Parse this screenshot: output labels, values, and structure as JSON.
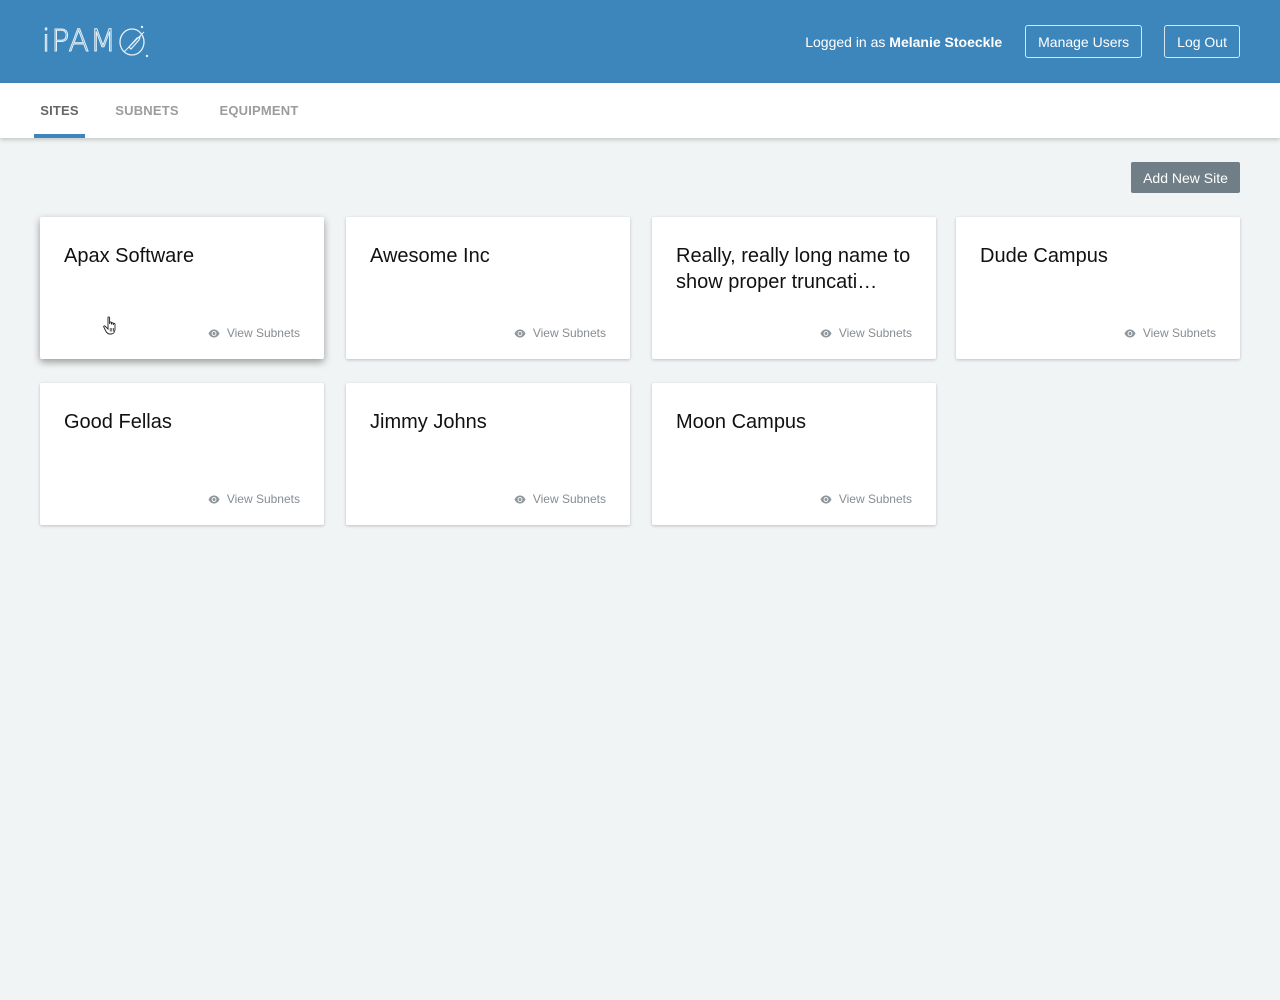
{
  "header": {
    "logo_text": "iPAM",
    "logged_in_prefix": "Logged in as ",
    "user_name": "Melanie Stoeckle",
    "buttons": [
      {
        "label": "Manage Users"
      },
      {
        "label": "Log Out"
      }
    ],
    "colors": {
      "brand": "#3d86bc"
    }
  },
  "tabs": [
    {
      "label": "SITES",
      "active": true
    },
    {
      "label": "SUBNETS",
      "active": false
    },
    {
      "label": "EQUIPMENT",
      "active": false
    }
  ],
  "toolbar": {
    "add_site_label": "Add New Site"
  },
  "sites": [
    {
      "name": "Apax Software",
      "link": "View Subnets",
      "link_icon": "eye-icon"
    },
    {
      "name": "Awesome Inc",
      "link": "View Subnets",
      "link_icon": "eye-icon"
    },
    {
      "name": "Really, really long name to show proper truncati…",
      "link": "View Subnets",
      "link_icon": "eye-icon"
    },
    {
      "name": "Dude Campus",
      "link": "View Subnets",
      "link_icon": "eye-icon"
    },
    {
      "name": "Good Fellas",
      "link": "View Subnets",
      "link_icon": "eye-icon"
    },
    {
      "name": "Jimmy Johns",
      "link": "View Subnets",
      "link_icon": "eye-icon"
    },
    {
      "name": "Moon Campus",
      "link": "View Subnets",
      "link_icon": "eye-icon"
    }
  ]
}
